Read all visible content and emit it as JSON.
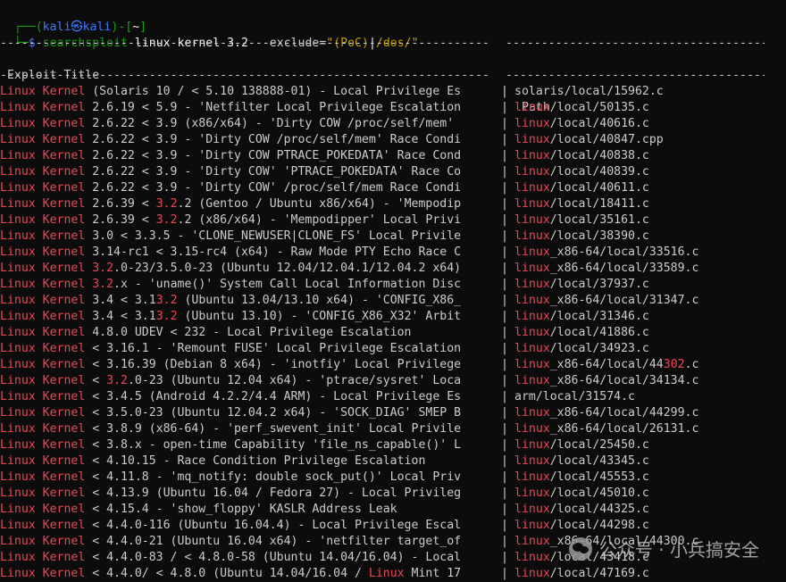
{
  "prompt": {
    "corner_top": "┌──(",
    "user": "kali",
    "at": "㉿",
    "host": "kali",
    "dir_open": ")-[",
    "dir": "~",
    "dir_close": "]",
    "corner_bottom": "└─",
    "dollar": "$ ",
    "cmd": "searchsploit",
    "args": " linux kernel 3.2 ",
    "opt": "--exclude=",
    "str_open": "\"",
    "str_val1": "(PoC)",
    "str_pipe": "|",
    "str_val2": "/dos/\""
  },
  "table": {
    "divider_left": "------------------------------------------------------------------------------------------------",
    "header_title": " Exploit Title",
    "header_sep": "|",
    "header_path": "Path",
    "rows": [
      {
        "t": "(Solaris 10 / < 5.10 138888-01) - Local Privilege Es",
        "p": "solaris/local/15962.c"
      },
      {
        "t": "2.6.19 < 5.9 - 'Netfilter Local Privilege Escalation",
        "p": "/local/50135.c"
      },
      {
        "t": "2.6.22 < 3.9 (x86/x64) - 'Dirty COW /proc/self/mem'",
        "p": "/local/40616.c"
      },
      {
        "t": "2.6.22 < 3.9 - 'Dirty COW /proc/self/mem' Race Condi",
        "p": "/local/40847.cpp"
      },
      {
        "t": "2.6.22 < 3.9 - 'Dirty COW PTRACE_POKEDATA' Race Cond",
        "p": "/local/40838.c"
      },
      {
        "t": "2.6.22 < 3.9 - 'Dirty COW' 'PTRACE_POKEDATA' Race Co",
        "p": "/local/40839.c"
      },
      {
        "t": "2.6.22 < 3.9 - 'Dirty COW' /proc/self/mem Race Condi",
        "p": "/local/40611.c"
      },
      {
        "t": "2.6.39 < 3.2.2 (Gentoo / Ubuntu x86/x64) - 'Mempodip",
        "p": "/local/18411.c"
      },
      {
        "t": "2.6.39 < 3.2.2 (x86/x64) - 'Mempodipper' Local Privi",
        "p": "/local/35161.c"
      },
      {
        "t": "3.0 < 3.3.5 - 'CLONE_NEWUSER|CLONE_FS' Local Privile",
        "p": "/local/38390.c"
      },
      {
        "t": "3.14-rc1 < 3.15-rc4 (x64) - Raw Mode PTY Echo Race C",
        "p": "_x86-64/local/33516.c"
      },
      {
        "t": "3.2.0-23/3.5.0-23 (Ubuntu 12.04/12.04.1/12.04.2 x64)",
        "p": "_x86-64/local/33589.c"
      },
      {
        "t": "3.2.x - 'uname()' System Call Local Information Disc",
        "p": "/local/37937.c"
      },
      {
        "t": "3.4 < 3.13.2 (Ubuntu 13.04/13.10 x64) - 'CONFIG_X86_",
        "p": "_x86-64/local/31347.c"
      },
      {
        "t": "3.4 < 3.13.2 (Ubuntu 13.10) - 'CONFIG_X86_X32' Arbit",
        "p": "/local/31346.c"
      },
      {
        "t": "4.8.0 UDEV < 232 - Local Privilege Escalation",
        "p": "/local/41886.c"
      },
      {
        "t": "< 3.16.1 - 'Remount FUSE' Local Privilege Escalation",
        "p": "/local/34923.c"
      },
      {
        "t": "< 3.16.39 (Debian 8 x64) - 'inotfiy' Local Privilege",
        "p": "_x86-64/local/44302.c"
      },
      {
        "t": "< 3.2.0-23 (Ubuntu 12.04 x64) - 'ptrace/sysret' Loca",
        "p": "_x86-64/local/34134.c"
      },
      {
        "t": "< 3.4.5 (Android 4.2.2/4.4 ARM) - Local Privilege Es",
        "p": "arm/local/31574.c"
      },
      {
        "t": "< 3.5.0-23 (Ubuntu 12.04.2 x64) - 'SOCK_DIAG' SMEP B",
        "p": "_x86-64/local/44299.c"
      },
      {
        "t": "< 3.8.9 (x86-64) - 'perf_swevent_init' Local Privile",
        "p": "_x86-64/local/26131.c"
      },
      {
        "t": "< 3.8.x - open-time Capability 'file_ns_capable()' L",
        "p": "/local/25450.c"
      },
      {
        "t": "< 4.10.15 - Race Condition Privilege Escalation",
        "p": "/local/43345.c"
      },
      {
        "t": "< 4.11.8 - 'mq_notify: double sock_put()' Local Priv",
        "p": "/local/45553.c"
      },
      {
        "t": "< 4.13.9 (Ubuntu 16.04 / Fedora 27) - Local Privileg",
        "p": "/local/45010.c"
      },
      {
        "t": "< 4.15.4 - 'show_floppy' KASLR Address Leak",
        "p": "/local/44325.c"
      },
      {
        "t": "< 4.4.0-116 (Ubuntu 16.04.4) - Local Privilege Escal",
        "p": "/local/44298.c"
      },
      {
        "t": "< 4.4.0-21 (Ubuntu 16.04 x64) - 'netfilter target_of",
        "p": "_x86-64/local/44300.c"
      },
      {
        "t": "< 4.4.0-83 / < 4.8.0-58 (Ubuntu 14.04/16.04) - Local",
        "p": "/local/43418.c"
      },
      {
        "t": "< 4.4.0/ < 4.8.0 (Ubuntu 14.04/16.04 / Linux Mint 17",
        "p": "/local/47169.c"
      }
    ],
    "row_prefix": "Linux Kernel ",
    "path_prefix": "linux"
  },
  "watermark": "公众号 · 小兵搞安全",
  "colors": {
    "red": "#e74856",
    "blue": "#3b78ff",
    "green": "#13a10e",
    "yellow": "#c19c00",
    "bg": "#0c0c0c"
  }
}
